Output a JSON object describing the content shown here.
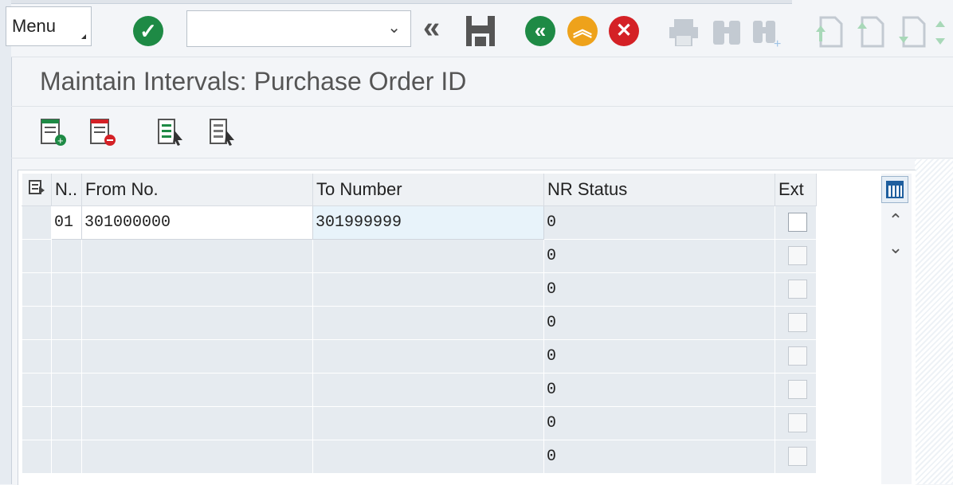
{
  "toolbar": {
    "menu_label": "Menu",
    "command_value": ""
  },
  "page": {
    "title": "Maintain Intervals: Purchase Order ID"
  },
  "table": {
    "columns": [
      "N..",
      "From No.",
      "To Number",
      "NR Status",
      "Ext"
    ],
    "rows": [
      {
        "no": "01",
        "from": "301000000",
        "to": "301999999",
        "status": "0",
        "ext": false
      },
      {
        "no": "",
        "from": "",
        "to": "",
        "status": "0",
        "ext": false
      },
      {
        "no": "",
        "from": "",
        "to": "",
        "status": "0",
        "ext": false
      },
      {
        "no": "",
        "from": "",
        "to": "",
        "status": "0",
        "ext": false
      },
      {
        "no": "",
        "from": "",
        "to": "",
        "status": "0",
        "ext": false
      },
      {
        "no": "",
        "from": "",
        "to": "",
        "status": "0",
        "ext": false
      },
      {
        "no": "",
        "from": "",
        "to": "",
        "status": "0",
        "ext": false
      },
      {
        "no": "",
        "from": "",
        "to": "",
        "status": "0",
        "ext": false
      }
    ]
  },
  "colors": {
    "green": "#1e8a45",
    "orange": "#eea21b",
    "red": "#d42126",
    "disabled": "#c3cad2",
    "disabled_green": "#a8d8b8"
  }
}
